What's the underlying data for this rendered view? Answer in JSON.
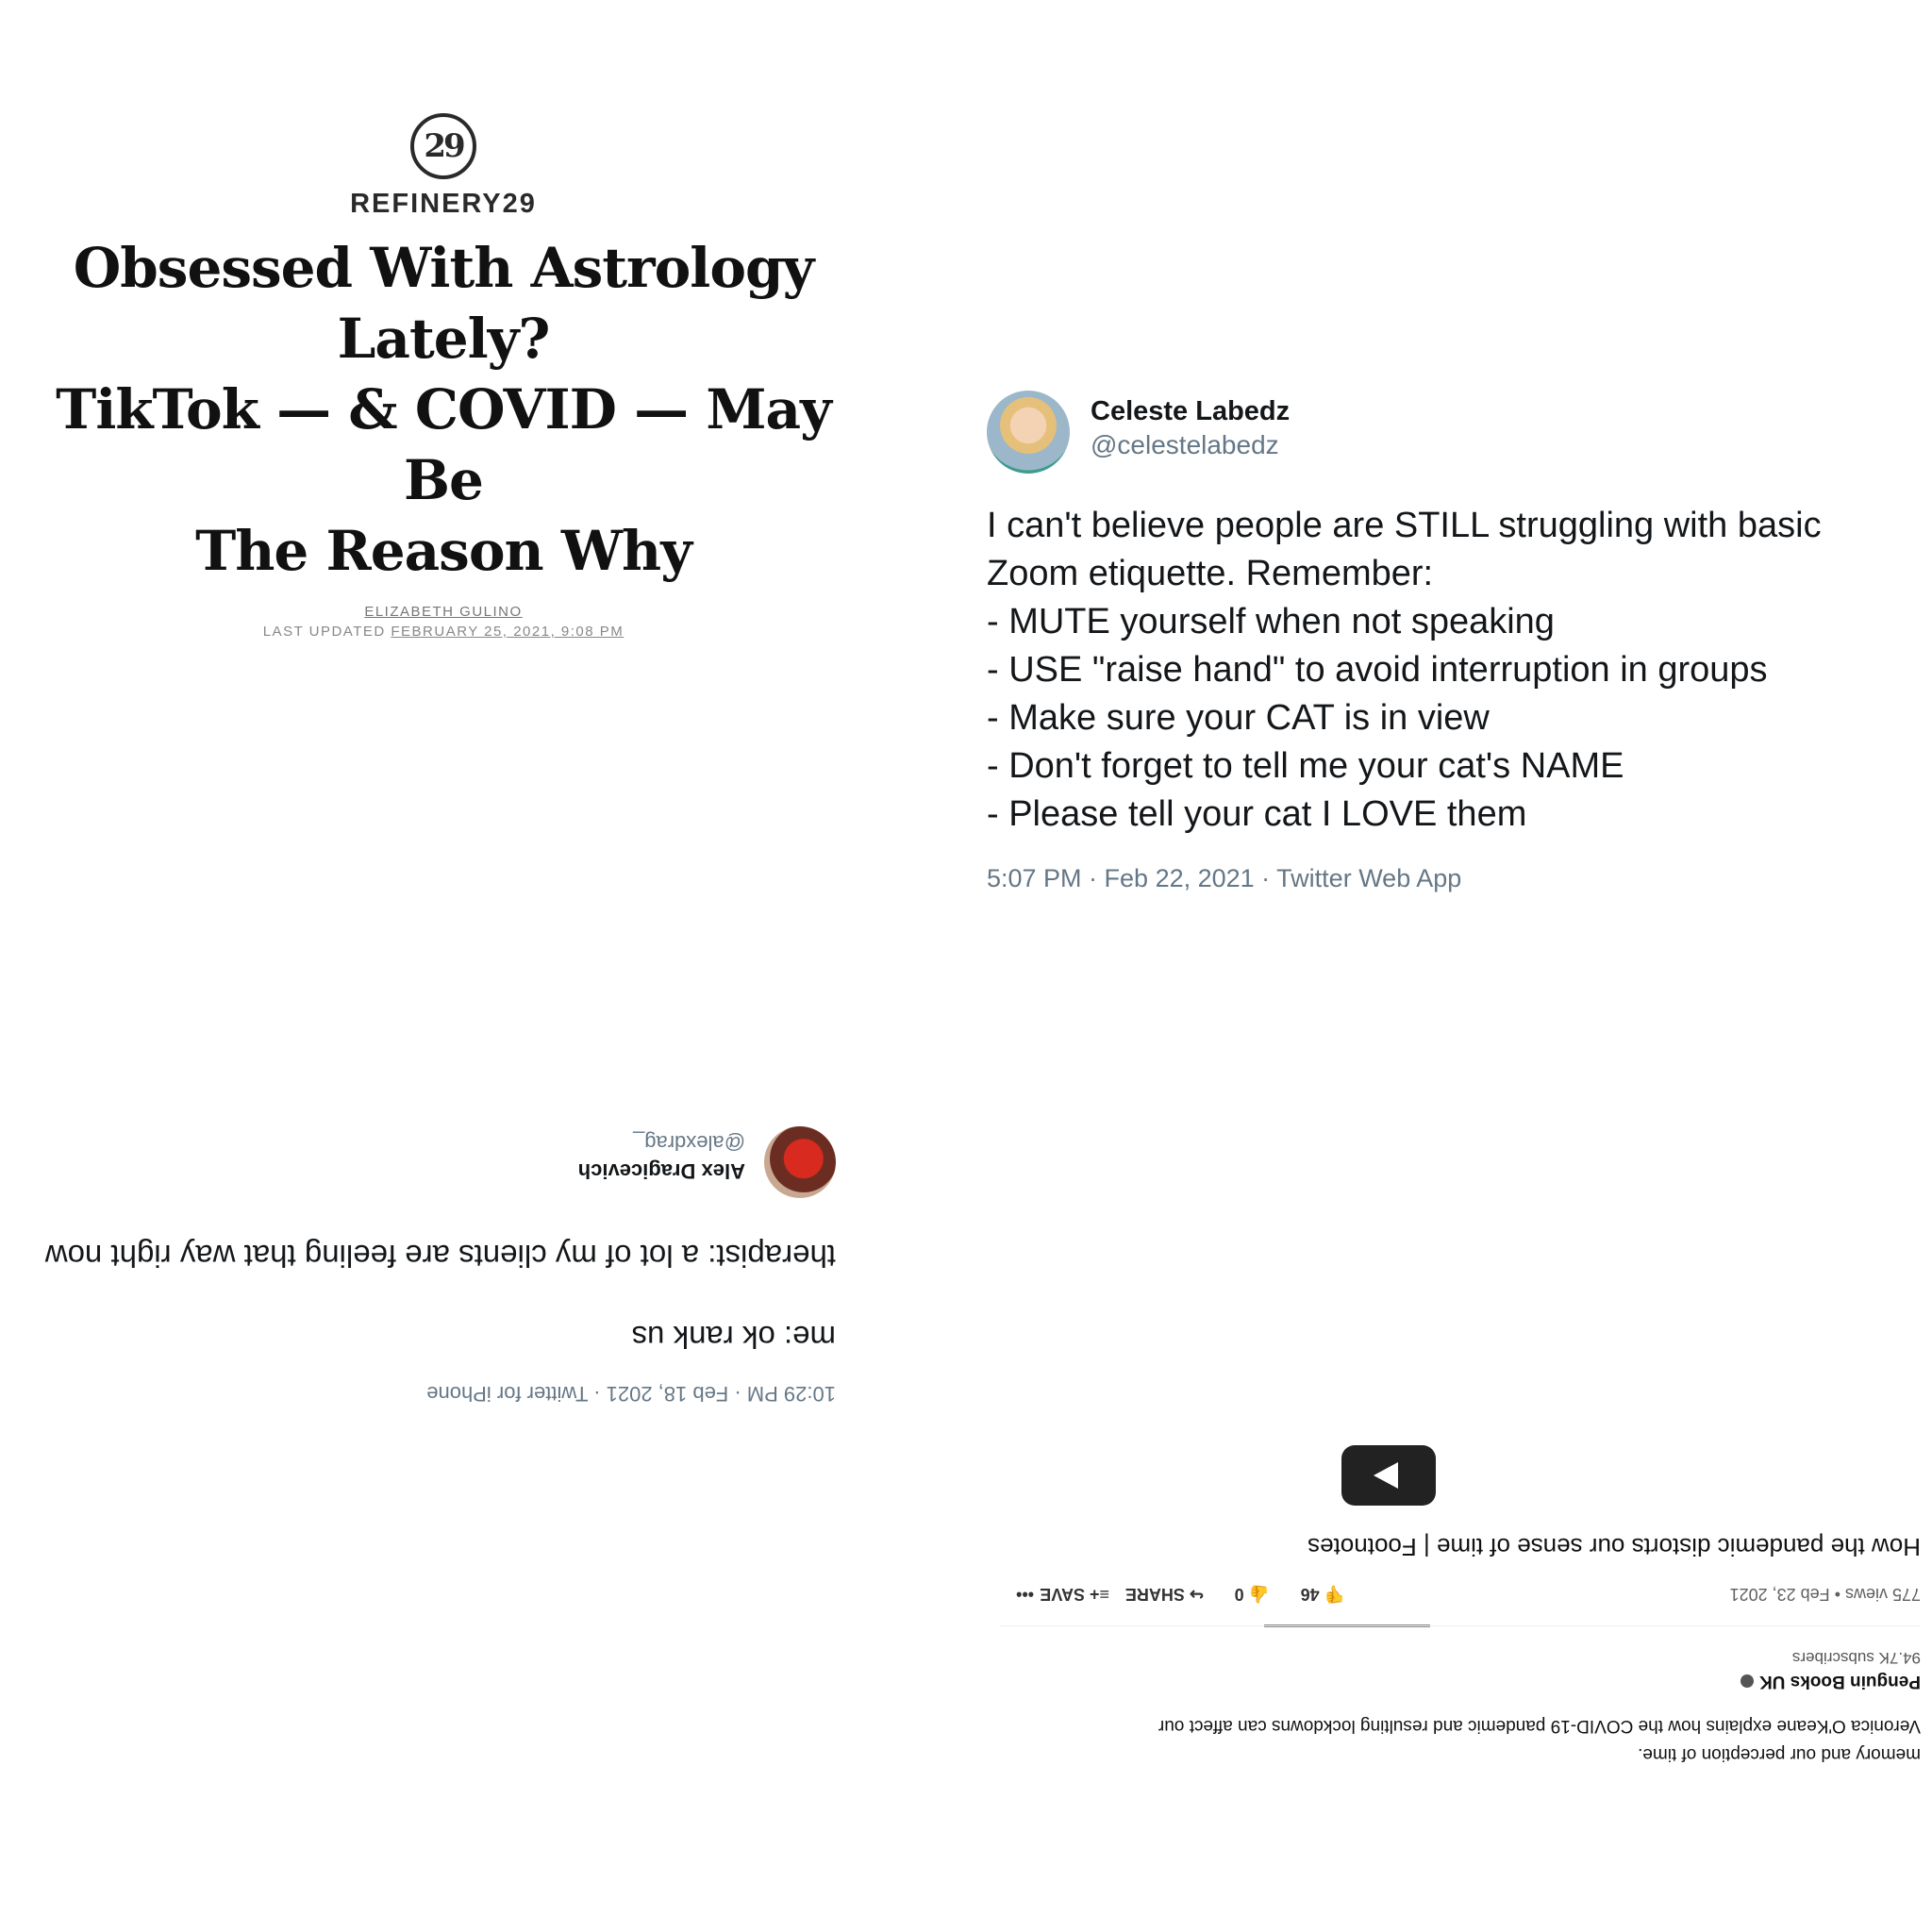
{
  "refinery29": {
    "logo_text": "29",
    "brand": "REFINERY29",
    "headline_lines": [
      "Obsessed With Astrology Lately?",
      "TikTok — & COVID — May Be",
      "The Reason Why"
    ],
    "byline": "ELIZABETH GULINO",
    "updated_label": "LAST UPDATED",
    "updated_date": "FEBRUARY 25, 2021, 9:08 PM"
  },
  "tweet_celeste": {
    "name": "Celeste Labedz",
    "handle": "@celestelabedz",
    "lines": [
      "I can't believe people are STILL struggling with basic",
      "Zoom etiquette. Remember:",
      "- MUTE yourself when not speaking",
      "- USE \"raise hand\" to avoid interruption in groups",
      "- Make sure your CAT is in view",
      "- Don't forget to tell me your cat's NAME",
      "- Please tell your cat I LOVE them"
    ],
    "meta": "5:07 PM · Feb 22, 2021 · Twitter Web App"
  },
  "tweet_alex": {
    "name": "Alex Dragicevich",
    "handle": "@alexdrag_",
    "line1": "therapist: a lot of my clients are feeling that way right now",
    "line2": "me: ok rank us",
    "meta": "10:29 PM · Feb 18, 2021 · Twitter for iPhone"
  },
  "youtube": {
    "title": "How the pandemic distorts our sense of time | Footnotes",
    "views_date": "775 views • Feb 23, 2021",
    "dislike_count": "46",
    "like_count": "0",
    "share_label": "SHARE",
    "save_label": "SAVE",
    "more_label": "•••",
    "channel_name": "Penguin Books UK",
    "subscribers": "94.7K subscribers",
    "desc_line1": "Veronica O'Keane explains how the COVID-19 pandemic and resulting lockdowns can affect our",
    "desc_line2": "memory and our perception of time."
  }
}
